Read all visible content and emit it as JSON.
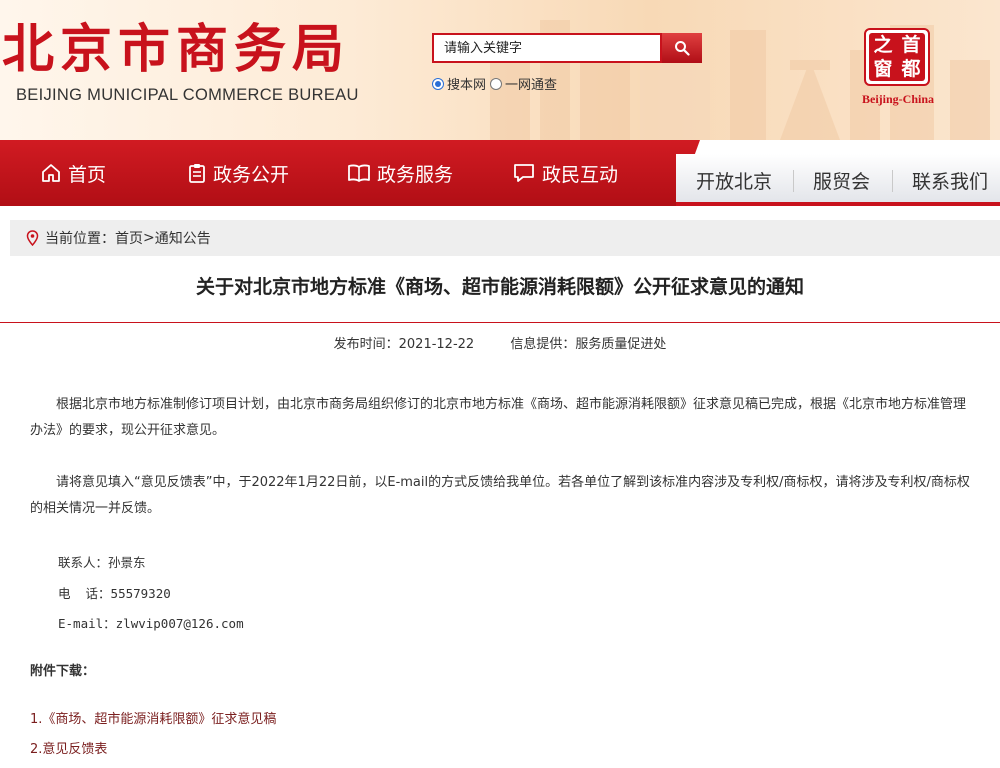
{
  "header": {
    "logo_cn": "北京市商务局",
    "logo_en": "BEIJING MUNICIPAL COMMERCE BUREAU",
    "search": {
      "placeholder": "请输入关键字"
    },
    "search_options": [
      {
        "label": "搜本网",
        "selected": true
      },
      {
        "label": "一网通查",
        "selected": false
      }
    ],
    "badge": {
      "chars": [
        "之",
        "首",
        "窗",
        "都"
      ],
      "caption": "Beijing-China"
    }
  },
  "nav": {
    "primary": [
      {
        "label": "首页",
        "icon": "home-icon"
      },
      {
        "label": "政务公开",
        "icon": "clipboard-icon"
      },
      {
        "label": "政务服务",
        "icon": "book-icon"
      },
      {
        "label": "政民互动",
        "icon": "chat-icon"
      }
    ],
    "secondary": [
      "开放北京",
      "服贸会",
      "联系我们"
    ]
  },
  "breadcrumb": {
    "prefix": "当前位置：",
    "home": "首页",
    "separator": ">",
    "current": "通知公告"
  },
  "article": {
    "title": "关于对北京市地方标准《商场、超市能源消耗限额》公开征求意见的通知",
    "publish_label": "发布时间：",
    "publish_date": "2021-12-22",
    "source_label": "信息提供：",
    "source": "服务质量促进处",
    "paragraphs": [
      "根据北京市地方标准制修订项目计划，由北京市商务局组织修订的北京市地方标准《商场、超市能源消耗限额》征求意见稿已完成，根据《北京市地方标准管理办法》的要求，现公开征求意见。",
      "请将意见填入“意见反馈表”中，于2022年1月22日前，以E-mail的方式反馈给我单位。若各单位了解到该标准内容涉及专利权/商标权，请将涉及专利权/商标权的相关情况一并反馈。"
    ],
    "contacts": [
      "联系人：孙景东",
      "电  话：55579320",
      "E-mail：zlwvip007@126.com"
    ],
    "attachments_heading": "附件下载：",
    "attachments": [
      "1.《商场、超市能源消耗限额》征求意见稿",
      "2.意见反馈表"
    ]
  },
  "colors": {
    "brand_red": "#c8121c",
    "nav_red": "#d11b22",
    "link": "#7a1e1e"
  }
}
